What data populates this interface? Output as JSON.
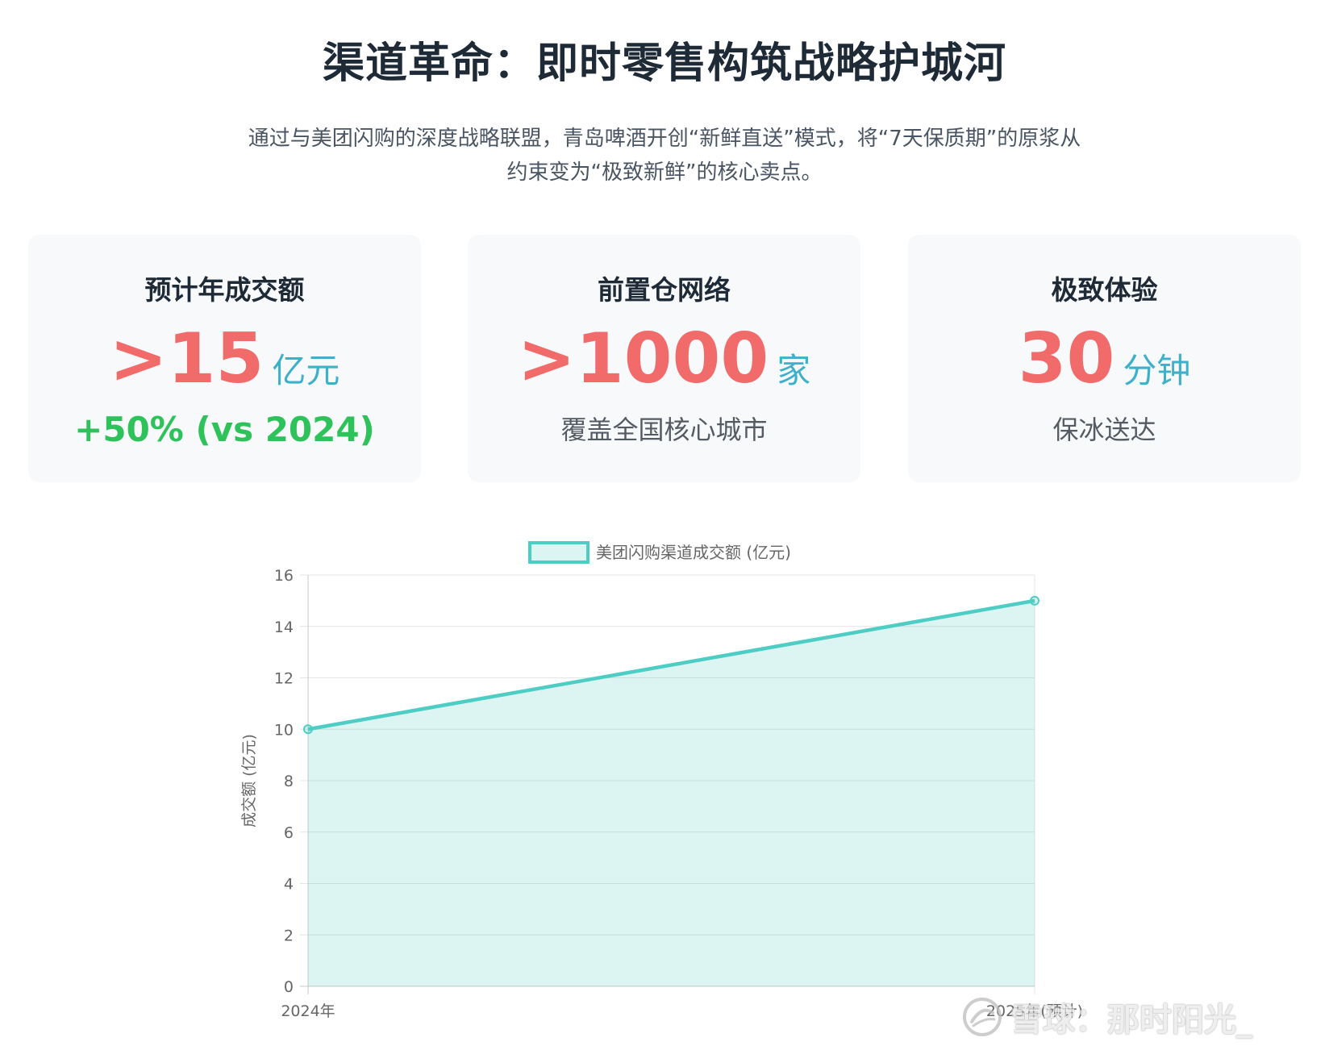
{
  "header": {
    "title": "渠道革命：即时零售构筑战略护城河",
    "subtitle_lines": [
      "通过与美团闪购的深度战略联盟，青岛啤酒开创“新鲜直送”模式，将“7天保质期”的原浆从",
      "约束变为“极致新鲜”的核心卖点。"
    ]
  },
  "cards": [
    {
      "title": "预计年成交额",
      "value": ">15",
      "unit": "亿元",
      "note": "+50% (vs 2024)"
    },
    {
      "title": "前置仓网络",
      "value": ">1000",
      "unit": "家",
      "note": "覆盖全国核心城市"
    },
    {
      "title": "极致体验",
      "value": "30",
      "unit": "分钟",
      "note": "保冰送达"
    }
  ],
  "colors": {
    "title": "#1f2a37",
    "value": "#f26b6b",
    "unit": "#3fb0c9",
    "growth": "#2ec25a",
    "note": "#555b63",
    "card_bg": "#f7f9fb",
    "series_line": "#4ecdc4",
    "series_fill": "rgba(78,205,196,0.2)"
  },
  "chart_data": {
    "type": "line",
    "categories": [
      "2024年",
      "2025年(预计)"
    ],
    "series": [
      {
        "name": "美团闪购渠道成交额 (亿元)",
        "values": [
          10,
          15
        ]
      }
    ],
    "xlabel": "",
    "ylabel": "成交额 (亿元)",
    "ylim": [
      0,
      16
    ],
    "ytick_step": 2,
    "grid": true,
    "legend": "top",
    "fill": true
  },
  "watermark": {
    "text": "雪球：那时阳光_",
    "icon": "snowball-logo-icon"
  }
}
